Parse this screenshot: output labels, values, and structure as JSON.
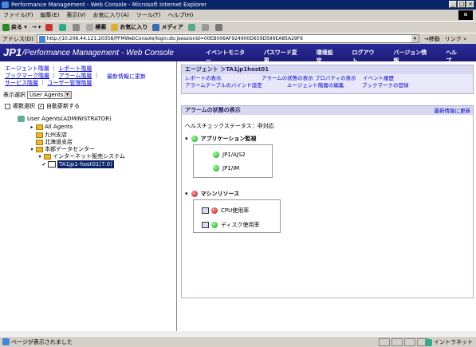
{
  "window": {
    "title": "Performance Management - Web Console - Microsoft Internet Explorer"
  },
  "menubar": [
    "ファイル(F)",
    "編集(E)",
    "表示(V)",
    "お気に入り(A)",
    "ツール(T)",
    "ヘルプ(H)"
  ],
  "toolbar": [
    "戻る",
    "検索",
    "お気に入り",
    "メディア"
  ],
  "address": {
    "label": "アドレス(D)",
    "url": "http://10.208.44.121:20358/PFMWebConsole/login.do;jsessionid=00EB006AF924900D659D599EA85A29F6",
    "go": "移動",
    "links": "リンク"
  },
  "app": {
    "logo": "JP1",
    "title": "/Performance Management - Web Console",
    "nav": [
      "イベントモニター",
      "パスワード変更",
      "環境設定",
      "ログアウト",
      "バージョン情報",
      "ヘルプ"
    ]
  },
  "left": {
    "links": {
      "agent_hierarchy": "エージェント階層",
      "report_hierarchy": "レポート階層",
      "bookmark_hierarchy": "ブックマーク階層",
      "alarm_hierarchy": "アラーム階層",
      "service_hierarchy": "サービス階層",
      "user_hierarchy": "ユーザー管理階層"
    },
    "refresh": "最新情報に更新",
    "display_label": "表示選択",
    "display_value": "User Agents",
    "multi_select": "複数選択",
    "auto_refresh": "自動更新する",
    "tree": {
      "root": "User Agents(ADMINISTRATOR)",
      "all_agents": "All Agents",
      "kyushu": "九州支店",
      "hokkaido": "北海道支店",
      "datacenter": "本部データセンター",
      "internet": "インターネット販売システム",
      "host": "TA1jp1-host01(7.0)"
    }
  },
  "right": {
    "header_title": "エージェント ＞TA1jp1host01",
    "links": [
      "レポートの表示",
      "アラームの状態の表示",
      "プロパティの表示",
      "イベント履歴",
      "アラームテーブルのバインド設定",
      "エージェント階層の編集",
      "ブックマークの登録"
    ],
    "panel_title": "アラームの状態の表示",
    "panel_refresh": "最新情報に更新",
    "health": "ヘルスチェックステータス：非対応",
    "groups": {
      "app": "アプリケーション監視",
      "app_items": [
        "JP1/AJS2",
        "JP1/IM"
      ],
      "machine": "マシンリソース",
      "machine_items": [
        "CPU使用率",
        "ディスク使用率"
      ]
    }
  },
  "status": {
    "text": "ページが表示されました",
    "zone": "イントラネット"
  }
}
